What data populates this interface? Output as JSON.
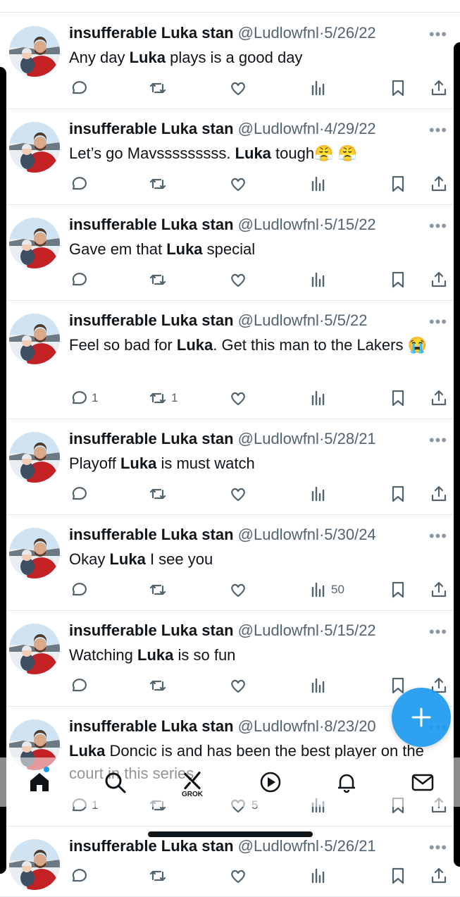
{
  "tweets": [
    {
      "name": "insufferable Luka stan",
      "handle": "@Ludlowfnl",
      "date": "5/26/22",
      "text_parts": [
        {
          "t": "Any day ",
          "b": false
        },
        {
          "t": "Luka",
          "b": true
        },
        {
          "t": " plays is a good day",
          "b": false
        }
      ],
      "replies": "",
      "retweets": "",
      "likes": "",
      "views": ""
    },
    {
      "name": "insufferable Luka stan",
      "handle": "@Ludlowfnl",
      "date": "4/29/22",
      "text_parts": [
        {
          "t": "Let’s go Mavsssssssss. ",
          "b": false
        },
        {
          "t": "Luka",
          "b": true
        },
        {
          "t": " tough😤 😤",
          "b": false
        }
      ],
      "replies": "",
      "retweets": "",
      "likes": "",
      "views": ""
    },
    {
      "name": "insufferable Luka stan",
      "handle": "@Ludlowfnl",
      "date": "5/15/22",
      "text_parts": [
        {
          "t": "Gave em that ",
          "b": false
        },
        {
          "t": "Luka",
          "b": true
        },
        {
          "t": " special",
          "b": false
        }
      ],
      "replies": "",
      "retweets": "",
      "likes": "",
      "views": ""
    },
    {
      "name": "insufferable Luka stan",
      "handle": "@Ludlowfnl",
      "date": "5/5/22",
      "text_parts": [
        {
          "t": "Feel so bad for ",
          "b": false
        },
        {
          "t": "Luka",
          "b": true
        },
        {
          "t": ". Get this man to the Lakers 😭",
          "b": false
        }
      ],
      "replies": "1",
      "retweets": "1",
      "likes": "",
      "views": ""
    },
    {
      "name": "insufferable Luka stan",
      "handle": "@Ludlowfnl",
      "date": "5/28/21",
      "text_parts": [
        {
          "t": "Playoff ",
          "b": false
        },
        {
          "t": "Luka",
          "b": true
        },
        {
          "t": " is must watch",
          "b": false
        }
      ],
      "replies": "",
      "retweets": "",
      "likes": "",
      "views": ""
    },
    {
      "name": "insufferable Luka stan",
      "handle": "@Ludlowfnl",
      "date": "5/30/24",
      "text_parts": [
        {
          "t": "Okay ",
          "b": false
        },
        {
          "t": "Luka",
          "b": true
        },
        {
          "t": " I see you",
          "b": false
        }
      ],
      "replies": "",
      "retweets": "",
      "likes": "",
      "views": "50"
    },
    {
      "name": "insufferable Luka stan",
      "handle": "@Ludlowfnl",
      "date": "5/15/22",
      "text_parts": [
        {
          "t": "Watching ",
          "b": false
        },
        {
          "t": "Luka",
          "b": true
        },
        {
          "t": " is so fun",
          "b": false
        }
      ],
      "replies": "",
      "retweets": "",
      "likes": "",
      "views": ""
    },
    {
      "name": "insufferable Luka stan",
      "handle": "@Ludlowfnl",
      "date": "8/23/20",
      "text_parts": [
        {
          "t": "Luka",
          "b": true
        },
        {
          "t": " Doncic is and has been the best player on the court in this series",
          "b": false
        }
      ],
      "replies": "1",
      "retweets": "",
      "likes": "5",
      "views": ""
    },
    {
      "name": "insufferable Luka stan",
      "handle": "@Ludlowfnl",
      "date": "5/26/21",
      "text_parts": [],
      "replies": "",
      "retweets": "",
      "likes": "",
      "views": ""
    }
  ],
  "nav": {
    "grok_label": "GROK"
  },
  "icons": [
    "reply-icon",
    "retweet-icon",
    "like-icon",
    "views-icon",
    "bookmark-icon",
    "share-icon",
    "more-icon",
    "home-icon",
    "search-icon",
    "grok-icon",
    "video-icon",
    "bell-icon",
    "mail-icon",
    "plus-icon"
  ],
  "colors": {
    "accent": "#1d9bf0",
    "text": "#0f1419",
    "muted": "#536471",
    "divider": "#e6e9ec"
  }
}
